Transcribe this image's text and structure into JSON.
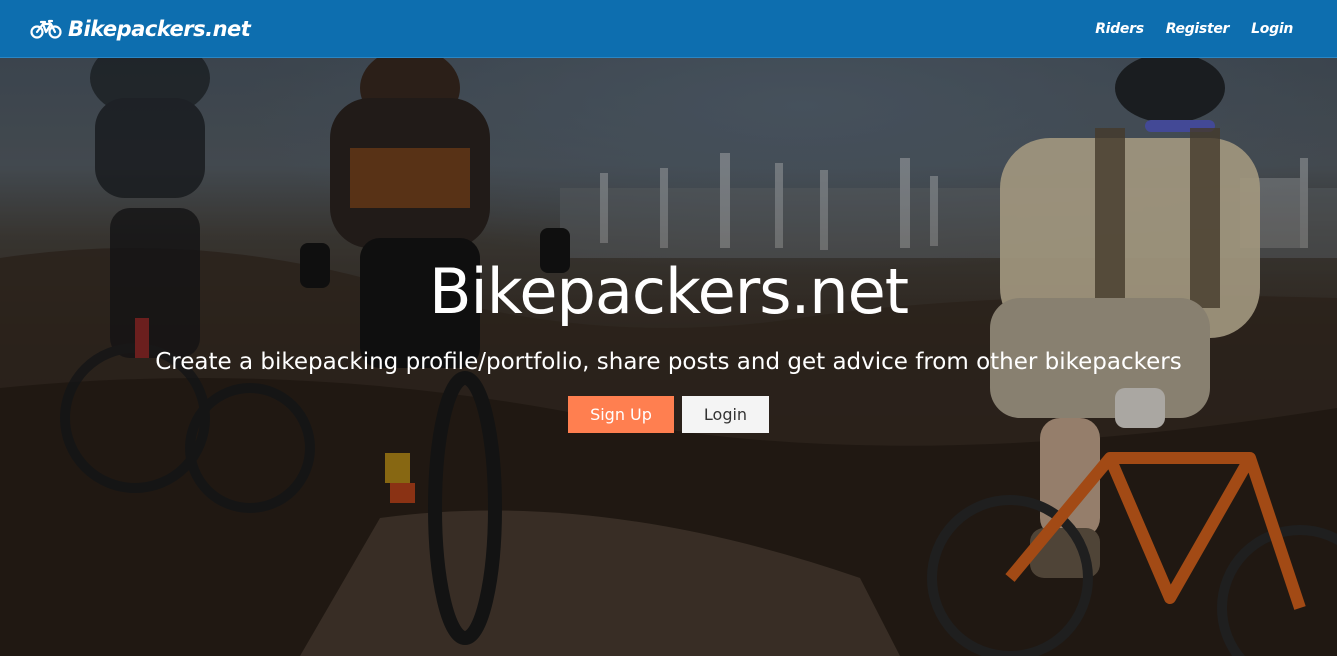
{
  "navbar": {
    "brand_label": "Bikepackers.net",
    "brand_icon": "bicycle-icon",
    "links": [
      {
        "label": "Riders"
      },
      {
        "label": "Register"
      },
      {
        "label": "Login"
      }
    ],
    "background_color": "#0d6eaf"
  },
  "hero": {
    "title": "Bikepackers.net",
    "tagline": "Create a bikepacking profile/portfolio, share posts and get advice from other bikepackers",
    "buttons": {
      "signup_label": "Sign Up",
      "login_label": "Login"
    },
    "background_image": "photo of mountain bikers riding a dirt trail",
    "signup_color": "#ff7f50"
  }
}
